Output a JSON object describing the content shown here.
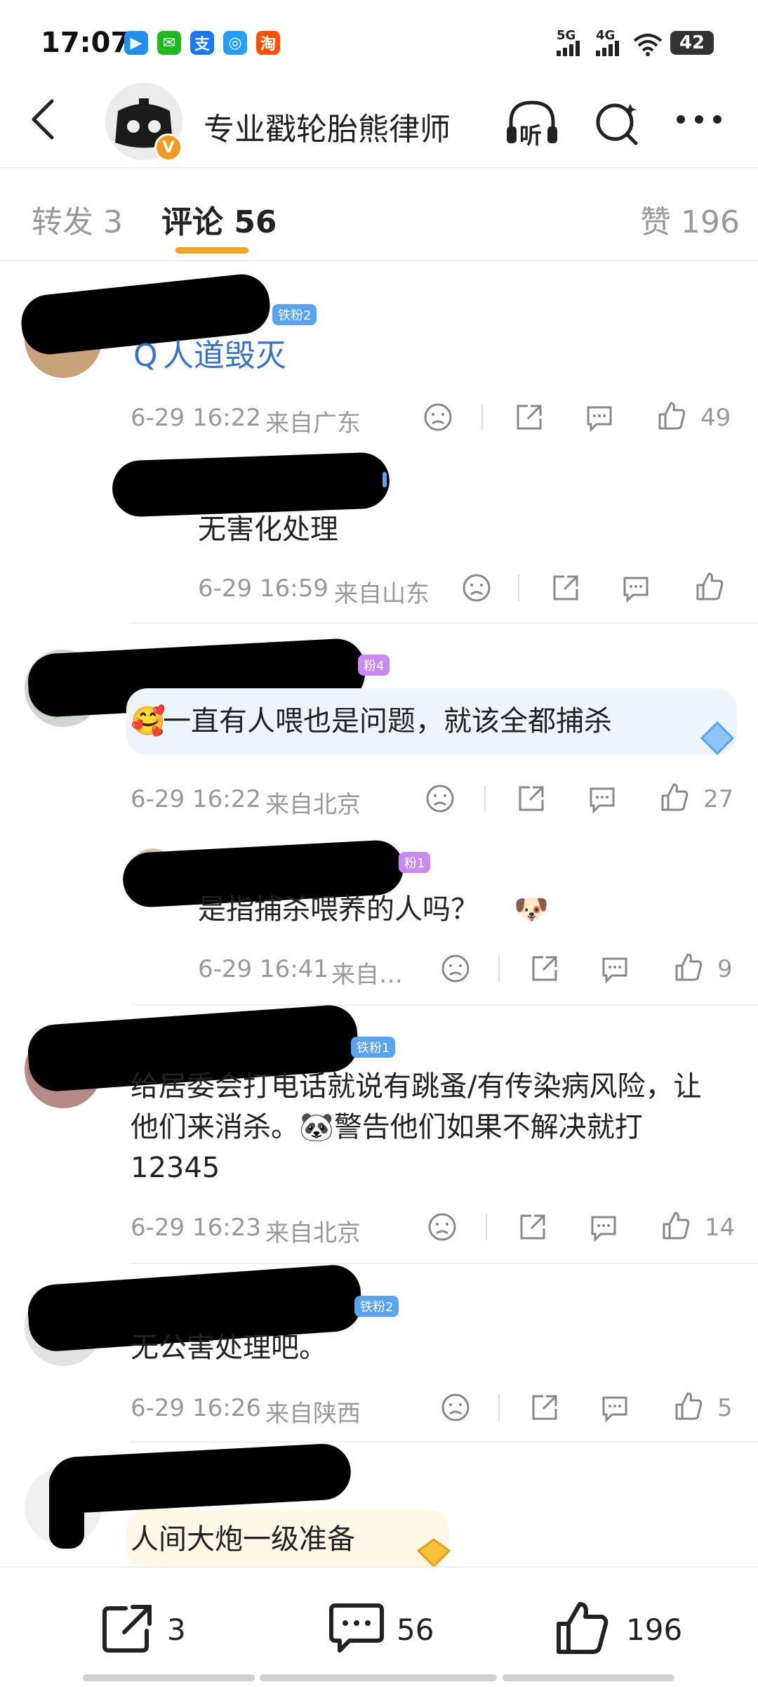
{
  "status_bar": {
    "time": "17:07",
    "apps": [
      {
        "icon": "tencent-video-icon",
        "color": "#1f8ff0",
        "glyph": "▶"
      },
      {
        "icon": "wechat-icon",
        "color": "#1fb922",
        "glyph": "✉"
      },
      {
        "icon": "alipay-icon",
        "color": "#1677ff",
        "glyph": "支"
      },
      {
        "icon": "qq-browser-icon",
        "color": "#22a0f5",
        "glyph": "◎"
      },
      {
        "icon": "taobao-icon",
        "color": "#ff5000",
        "glyph": "淘"
      }
    ],
    "network1": "5G",
    "network2": "4G",
    "battery": "42"
  },
  "header": {
    "user_name": "专业戳轮胎熊律师",
    "verified_badge": "V",
    "icons": [
      "back-icon",
      "listen-icon",
      "search-icon",
      "more-icon"
    ],
    "listen_label": "听"
  },
  "tabs": {
    "repost": "转发 3",
    "comments": "评论 56",
    "likes": "赞 196"
  },
  "comments": [
    {
      "fan_badge": "铁粉2",
      "text": "人道毁灭",
      "search_prefix": "Q",
      "time": "6-29 16:22",
      "location": "来自广东",
      "likes": "49"
    },
    {
      "fan_badge": "",
      "text": "无害化处理",
      "time": "6-29 16:59",
      "location": "来自山东",
      "likes": ""
    },
    {
      "fan_badge": "粉4",
      "text": "一直有人喂也是问题，就该全都捕杀",
      "emoji": "🥰",
      "time": "6-29 16:22",
      "location": "来自北京",
      "likes": "27"
    },
    {
      "fan_badge": "粉1",
      "text": "是指捕杀喂养的人吗？",
      "emoji": "🐶",
      "time": "6-29 16:41",
      "location": "来自…",
      "likes": "9"
    },
    {
      "fan_badge": "铁粉1",
      "text": "给居委会打电话就说有跳蚤/有传染病风险，让他们来消杀。",
      "emoji": "🐼",
      "text2": "警告他们如果不解决就打12345",
      "time": "6-29 16:23",
      "location": "来自北京",
      "likes": "14"
    },
    {
      "fan_badge": "铁粉2",
      "text": "无公害处理吧。",
      "time": "6-29 16:26",
      "location": "来自陕西",
      "likes": "5"
    },
    {
      "fan_badge": "",
      "text": "人间大炮一级准备",
      "time": "",
      "location": "",
      "likes": ""
    }
  ],
  "bottom_bar": {
    "repost_count": "3",
    "comment_count": "56",
    "like_count": "196"
  },
  "colors": {
    "accent": "#f4a41c",
    "fan_badge": "#5aa3f0",
    "fan_badge_purple": "#c78af0",
    "muted": "#999999"
  }
}
